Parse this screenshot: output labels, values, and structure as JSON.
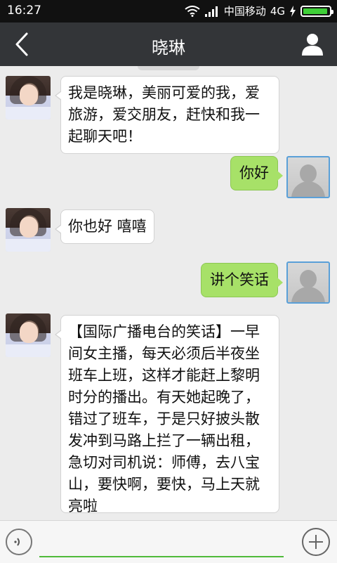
{
  "status_bar": {
    "time": "16:27",
    "carrier": "中国移动",
    "network": "4G",
    "battery_level": 1.0,
    "wifi_icon": "wifi-icon",
    "signal_icon": "signal-icon",
    "charging_icon": "charging-bolt-icon",
    "battery_color": "#3fcf38"
  },
  "title_bar": {
    "title": "晓琳",
    "back_icon": "back-chevron-icon",
    "profile_icon": "person-icon",
    "background": "#333538"
  },
  "messages": [
    {
      "from": "contact",
      "text": "我是晓琳，美丽可爱的我，爱旅游，爱交朋友，赶快和我一起聊天吧！"
    },
    {
      "from": "me",
      "text": "你好"
    },
    {
      "from": "contact",
      "text": "你也好 嘻嘻"
    },
    {
      "from": "me",
      "text": "讲个笑话"
    },
    {
      "from": "contact",
      "text": "【国际广播电台的笑话】一早间女主播，每天必须后半夜坐班车上班，这样才能赶上黎明时分的播出。有天她起晚了，错过了班车，于是只好披头散发冲到马路上拦了一辆出租，急切对司机说：师傅，去八宝山，要快啊，要快，马上天就亮啦"
    }
  ],
  "input_bar": {
    "value": "",
    "voice_icon": "voice-icon",
    "plus_icon": "plus-icon",
    "accent": "#4fba3a"
  },
  "colors": {
    "sent_bubble": "#a7e168",
    "received_bubble": "#ffffff",
    "chat_background": "#ececec"
  }
}
